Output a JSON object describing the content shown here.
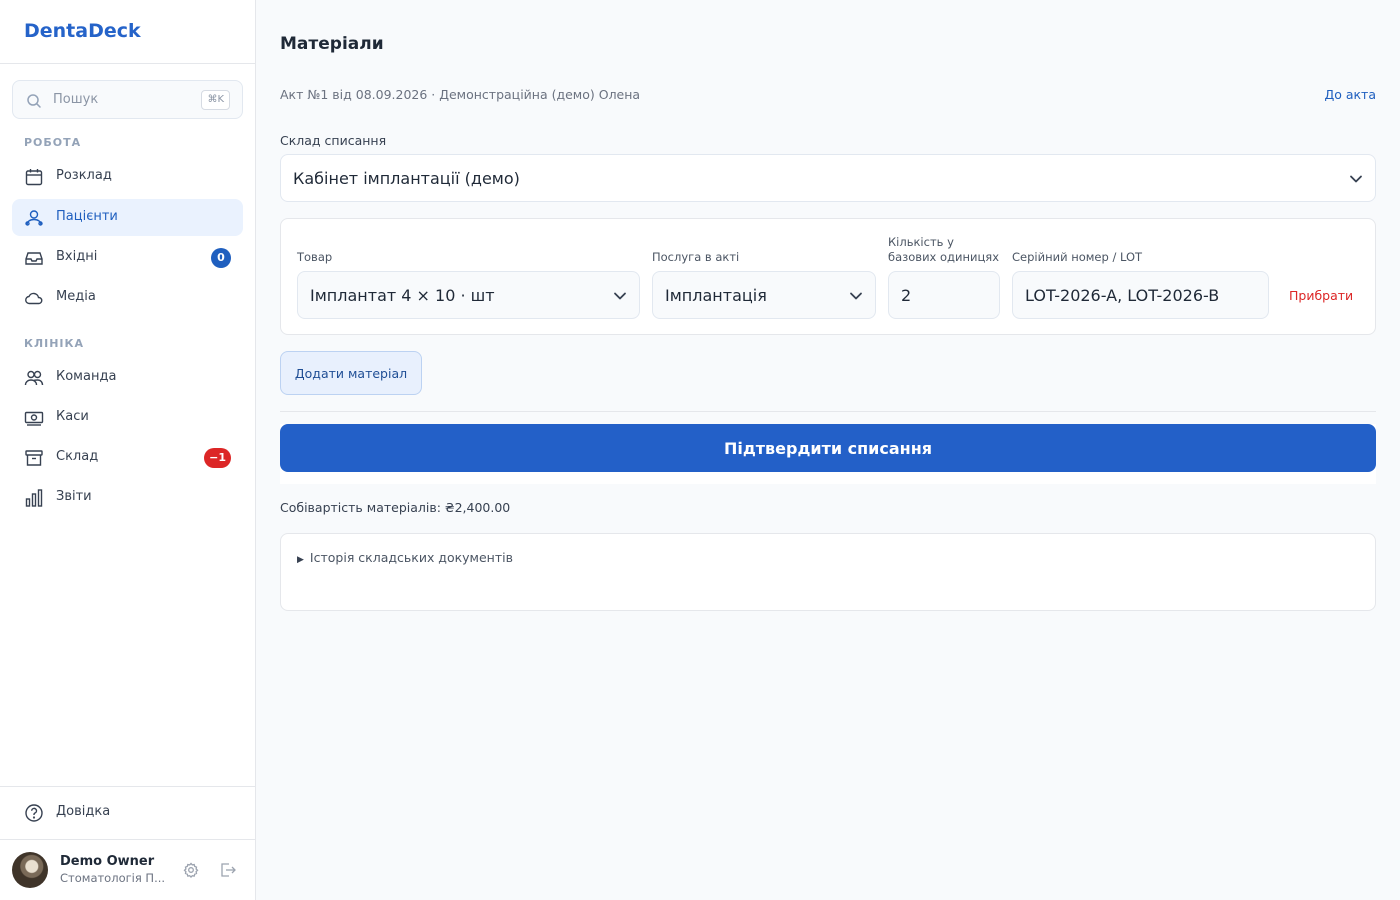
{
  "app": {
    "brand": "DentaDeck"
  },
  "search": {
    "placeholder": "Пошук",
    "shortcut": "⌘K"
  },
  "sidebar": {
    "sections": [
      {
        "title": "РОБОТА"
      },
      {
        "title": "КЛІНІКА"
      }
    ],
    "items": [
      {
        "label": "Розклад",
        "icon": "calendar-icon"
      },
      {
        "label": "Пацієнти",
        "icon": "users-icon",
        "active": true
      },
      {
        "label": "Вхідні",
        "icon": "inbox-icon",
        "badge": "0"
      },
      {
        "label": "Медіа",
        "icon": "cloud-icon"
      },
      {
        "label": "Команда",
        "icon": "team-icon"
      },
      {
        "label": "Каси",
        "icon": "cash-icon"
      },
      {
        "label": "Склад",
        "icon": "archive-icon",
        "badge": "−1"
      },
      {
        "label": "Звіти",
        "icon": "bar-chart-icon"
      }
    ],
    "help": {
      "label": "Довідка",
      "icon": "help-circle-icon"
    }
  },
  "user": {
    "name": "Demo Owner",
    "org": "Стоматологія П..."
  },
  "page": {
    "title": "Матеріали",
    "subtitle": "Акт №1 від 08.09.2026 · Демонстраційна (демо) Олена",
    "back_link": "До акта"
  },
  "warehouse": {
    "label": "Склад списання",
    "value": "Кабінет імплантації (демо)"
  },
  "material_row": {
    "product_label": "Товар",
    "product_value": "Імплантат 4 × 10 · шт",
    "service_label": "Послуга в акті",
    "service_value": "Імплантація",
    "qty_label_line1": "Кількість у",
    "qty_label_line2": "базових одиницях",
    "qty_value": "2",
    "serial_label": "Серійний номер / LOT",
    "serial_value": "LOT-2026-A, LOT-2026-B",
    "remove_label": "Прибрати"
  },
  "actions": {
    "add_material": "Додати матеріал",
    "confirm": "Підтвердити списання"
  },
  "cost": {
    "text": "Собівартість матеріалів: ₴2,400.00"
  },
  "history": {
    "marker": "▶",
    "label": "Історія складських документів"
  },
  "colors": {
    "accent": "#2360c8",
    "danger": "#dc2626",
    "active_bg": "#eaf2fe"
  }
}
